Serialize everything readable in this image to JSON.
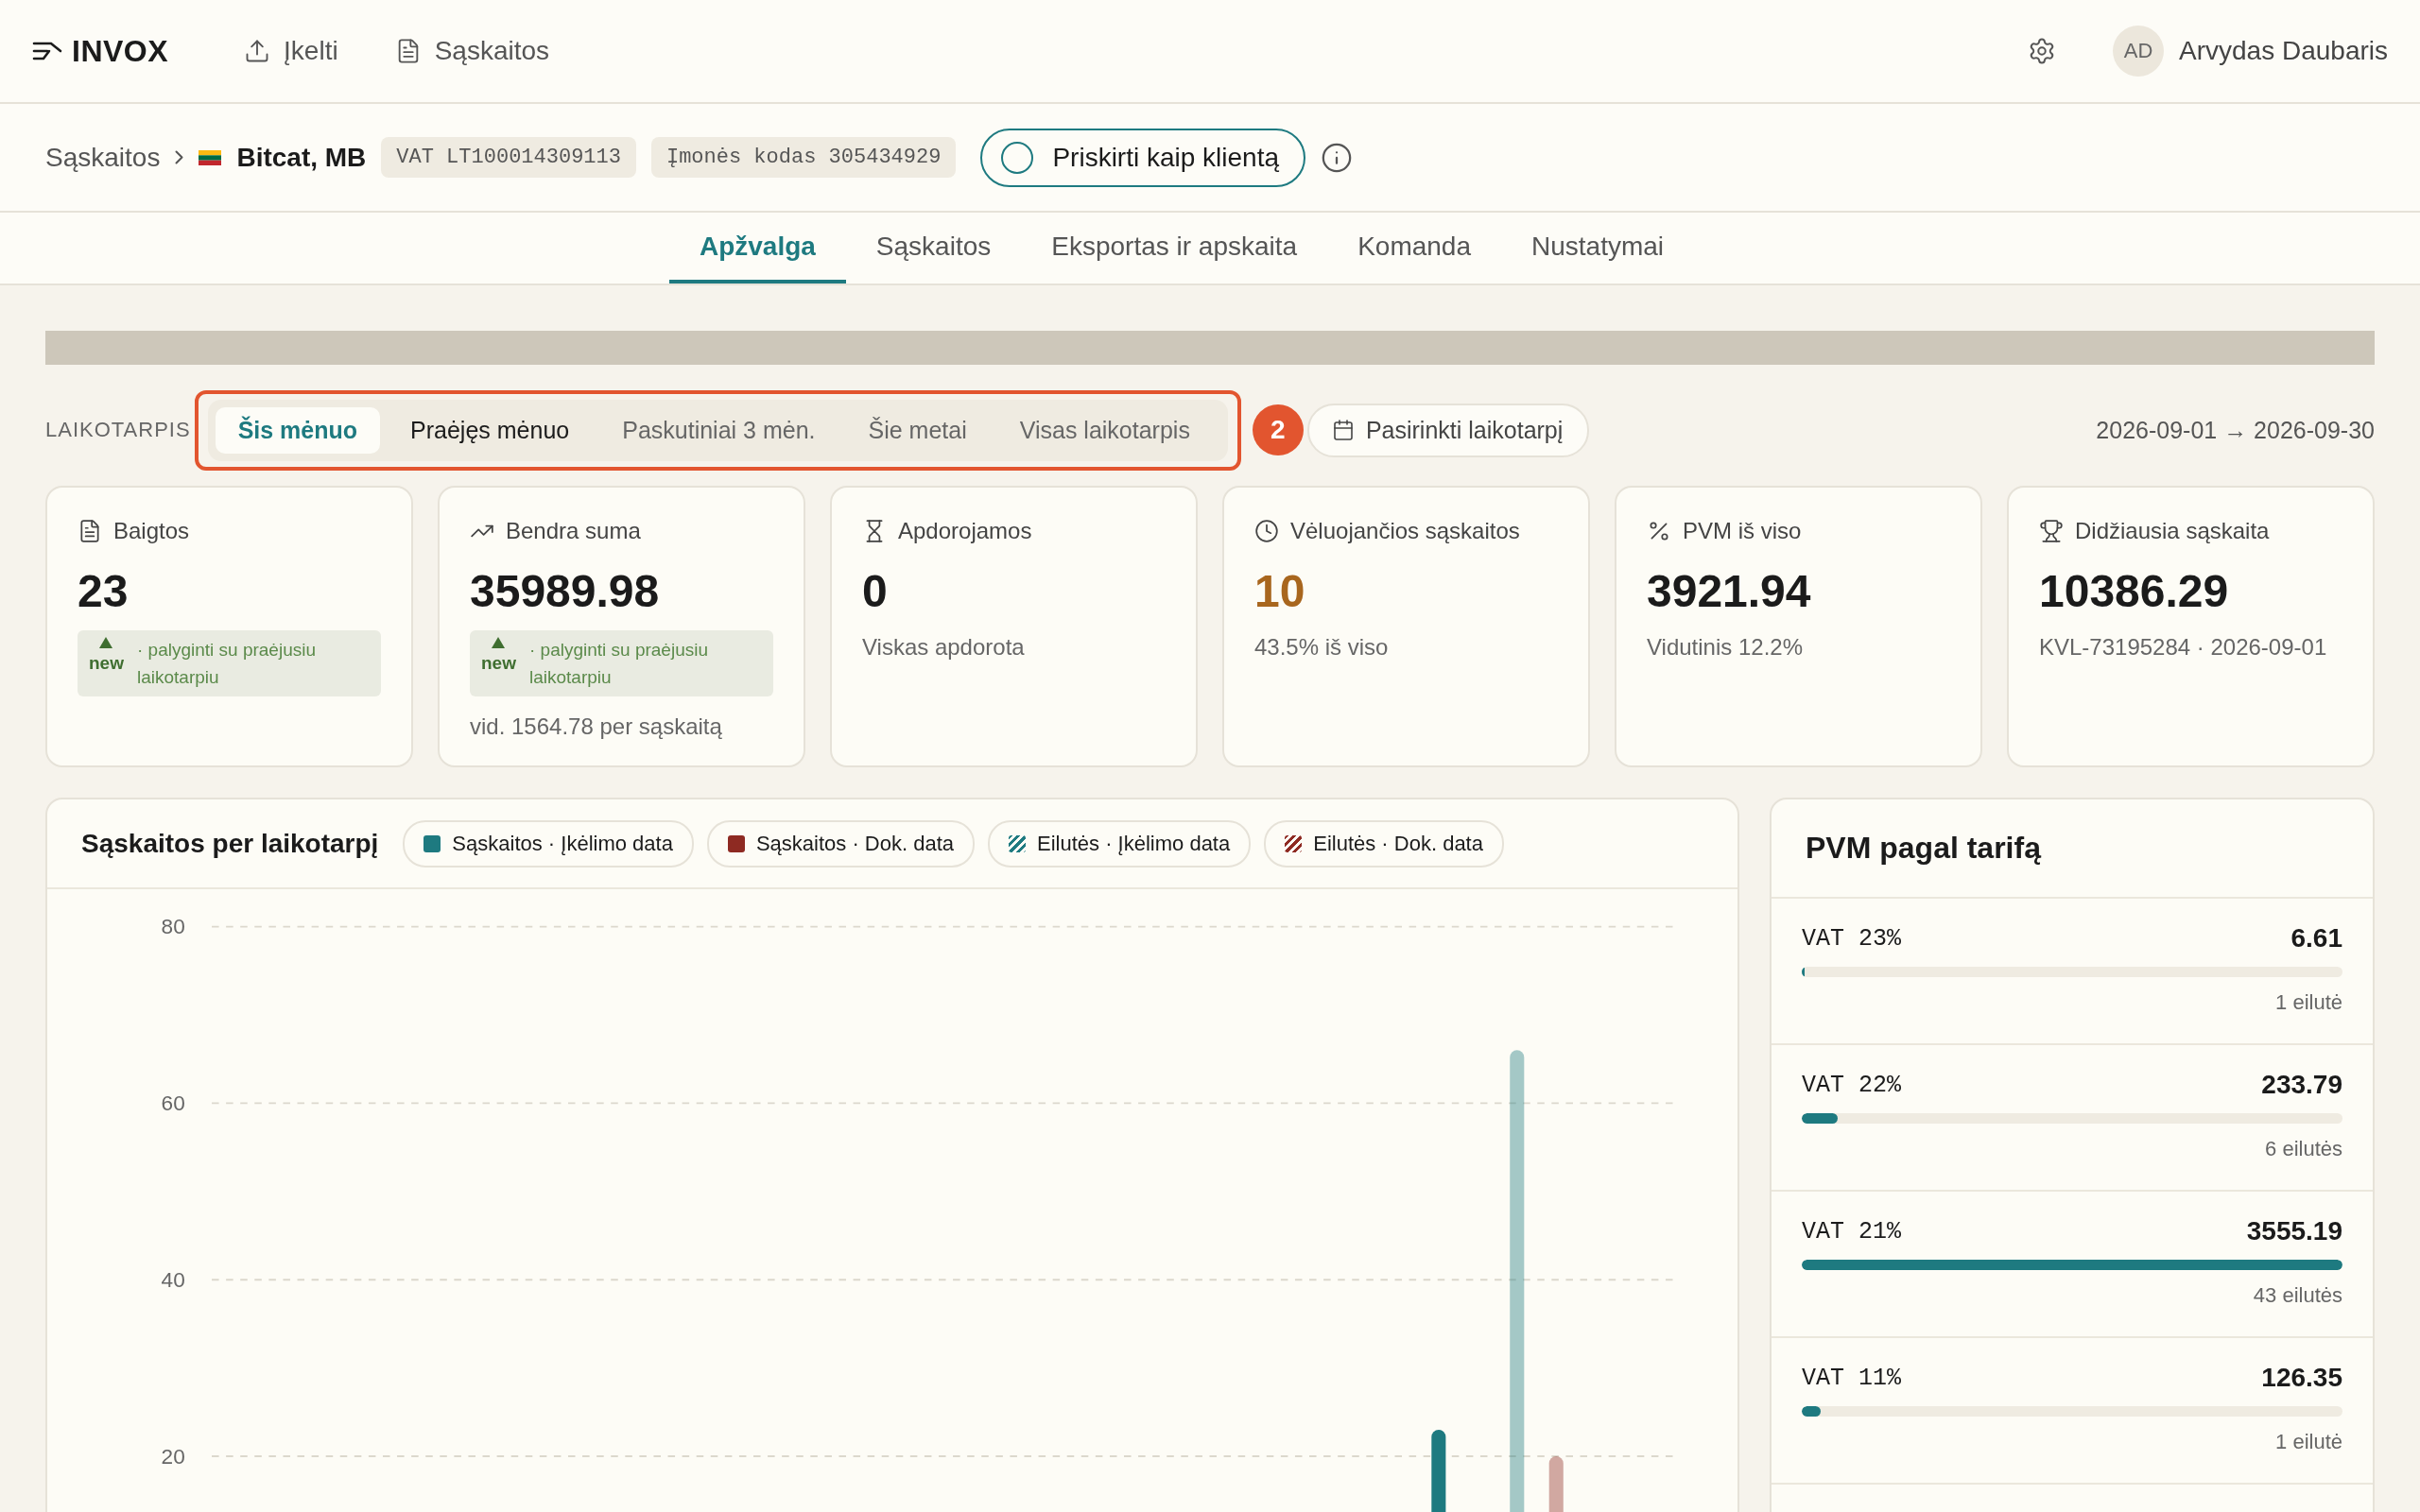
{
  "topbar": {
    "logo": "INVOX",
    "nav": [
      {
        "label": "Įkelti",
        "kind": "upload"
      },
      {
        "label": "Sąskaitos",
        "kind": "document"
      }
    ],
    "user": {
      "initials": "AD",
      "name": "Arvydas Daubaris"
    }
  },
  "breadcrumb": {
    "parent": "Sąskaitos",
    "company": "Bitcat, MB",
    "tags": [
      "VAT LT100014309113",
      "Įmonės kodas 305434929"
    ],
    "assign_button": "Priskirti kaip klientą"
  },
  "tabs": [
    {
      "label": "Apžvalga",
      "selected": true
    },
    {
      "label": "Sąskaitos",
      "selected": false
    },
    {
      "label": "Eksportas ir apskaita",
      "selected": false
    },
    {
      "label": "Komanda",
      "selected": false
    },
    {
      "label": "Nustatymai",
      "selected": false
    }
  ],
  "period": {
    "label": "LAIKOTARPIS",
    "options": [
      {
        "label": "Šis mėnuo",
        "selected": true
      },
      {
        "label": "Praėjęs mėnuo",
        "selected": false
      },
      {
        "label": "Paskutiniai 3 mėn.",
        "selected": false
      },
      {
        "label": "Šie metai",
        "selected": false
      },
      {
        "label": "Visas laikotarpis",
        "selected": false
      }
    ],
    "annotation_badge": "2",
    "custom_button": "Pasirinkti laikotarpį",
    "range": "2026-09-01 → 2026-09-30"
  },
  "cards": [
    {
      "kind": "document",
      "title": "Baigtos",
      "value": "23",
      "badge": {
        "tag": "new",
        "text": "· palyginti su praėjusiu laikotarpiu"
      }
    },
    {
      "kind": "trend",
      "title": "Bendra suma",
      "value": "35989.98",
      "badge": {
        "tag": "new",
        "text": "· palyginti su praėjusiu laikotarpiu"
      },
      "note": "vid. 1564.78 per sąskaitą"
    },
    {
      "kind": "hourglass",
      "title": "Apdorojamos",
      "value": "0",
      "note": "Viskas apdorota"
    },
    {
      "kind": "clock",
      "title": "Vėluojančios sąskaitos",
      "value": "10",
      "color": "#a8661e",
      "note": "43.5% iš viso"
    },
    {
      "kind": "percent",
      "title": "PVM iš viso",
      "value": "3921.94",
      "note": "Vidutinis 12.2%"
    },
    {
      "kind": "trophy",
      "title": "Didžiausia sąskaita",
      "value": "10386.29",
      "note": "KVL-73195284 · 2026-09-01"
    }
  ],
  "chart": {
    "title": "Sąskaitos per laikotarpį",
    "legend": [
      {
        "kind": "solid"
      },
      {
        "kind": "solid"
      },
      {
        "kind": "striped"
      },
      {
        "kind": "striped"
      }
    ],
    "chart_data": {
      "type": "bar",
      "grid": true,
      "yticks": [
        20,
        40,
        60,
        80
      ],
      "ylim": [
        0,
        80
      ],
      "series": [
        {
          "name": "Sąskaitos · Įkėlimo data",
          "color": "#1e7a80",
          "values": [
            23
          ]
        },
        {
          "name": "Sąskaitos · Dok. data",
          "color": "#8e2a22",
          "values": [
            null
          ]
        },
        {
          "name": "Eilutės · Įkėlimo data",
          "color": "#1e7a80",
          "values": [
            66
          ]
        },
        {
          "name": "Eilutės · Dok. data",
          "color": "#8e2a22",
          "values": [
            20
          ]
        }
      ]
    }
  },
  "vat_panel": {
    "title": "PVM pagal tarifą",
    "rows": [
      {
        "rate": "VAT 23%",
        "amount": "6.61",
        "level": 0.005,
        "lines": "1 eilutė"
      },
      {
        "rate": "VAT 22%",
        "amount": "233.79",
        "level": 0.066,
        "lines": "6 eilutės"
      },
      {
        "rate": "VAT 21%",
        "amount": "3555.19",
        "level": 1,
        "lines": "43 eilutės"
      },
      {
        "rate": "VAT 11%",
        "amount": "126.35",
        "level": 0.035,
        "lines": "1 eilutė"
      }
    ]
  }
}
